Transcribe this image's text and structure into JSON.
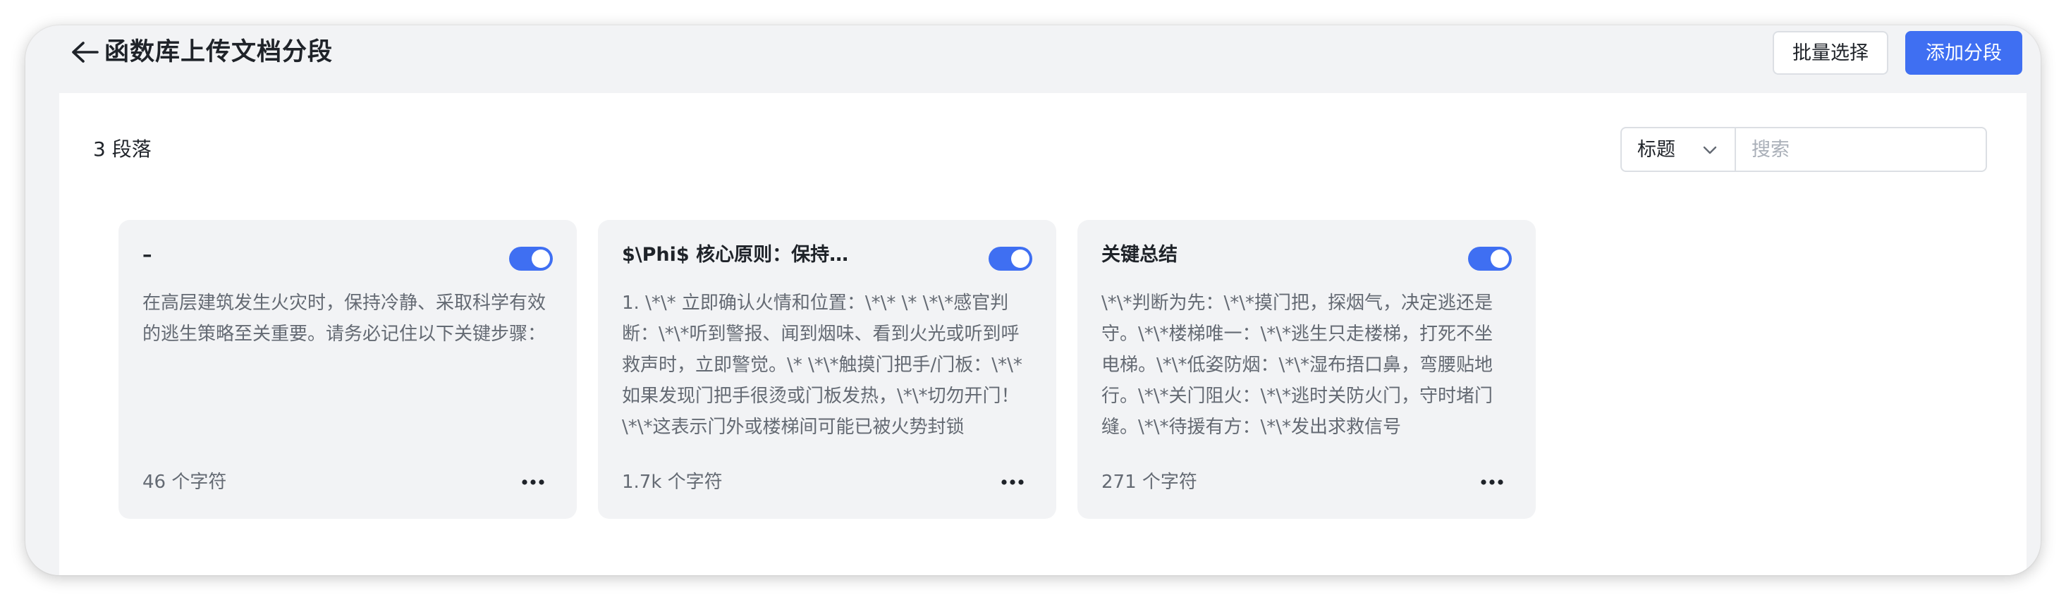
{
  "header": {
    "back_icon": "arrow-left-icon",
    "title": "函数库上传文档分段",
    "batch_select_label": "批量选择",
    "add_segment_label": "添加分段"
  },
  "toolbar": {
    "paragraph_count": "3 段落",
    "filter_selected": "标题",
    "search_placeholder": "搜索"
  },
  "cards": [
    {
      "title": "–",
      "enabled": true,
      "body": "在高层建筑发生火灾时，保持冷静、采取科学有效的逃生策略至关重要。请务必记住以下关键步骤：",
      "chars": "46 个字符"
    },
    {
      "title": "$\\Phi$ 核心原则：保持…",
      "enabled": true,
      "body": "1. \\*\\* 立即确认火情和位置：\\*\\* \\* \\*\\*感官判断：\\*\\*听到警报、闻到烟味、看到火光或听到呼救声时，立即警觉。\\* \\*\\*触摸门把手/门板：\\*\\*如果发现门把手很烫或门板发热，\\*\\*切勿开门！\\*\\*这表示门外或楼梯间可能已被火势封锁",
      "chars": "1.7k 个字符"
    },
    {
      "title": "关键总结",
      "enabled": true,
      "body": "\\*\\*判断为先：\\*\\*摸门把，探烟气，决定逃还是守。\\*\\*楼梯唯一：\\*\\*逃生只走楼梯，打死不坐电梯。\\*\\*低姿防烟：\\*\\*湿布捂口鼻，弯腰贴地行。\\*\\*关门阻火：\\*\\*逃时关防火门，守时堵门缝。\\*\\*待援有方：\\*\\*发出求救信号",
      "chars": "271 个字符"
    }
  ],
  "colors": {
    "accent": "#3f6ff2",
    "card_bg": "#f2f3f5",
    "window_bg": "#f2f3f5",
    "muted_text": "#646a73"
  }
}
